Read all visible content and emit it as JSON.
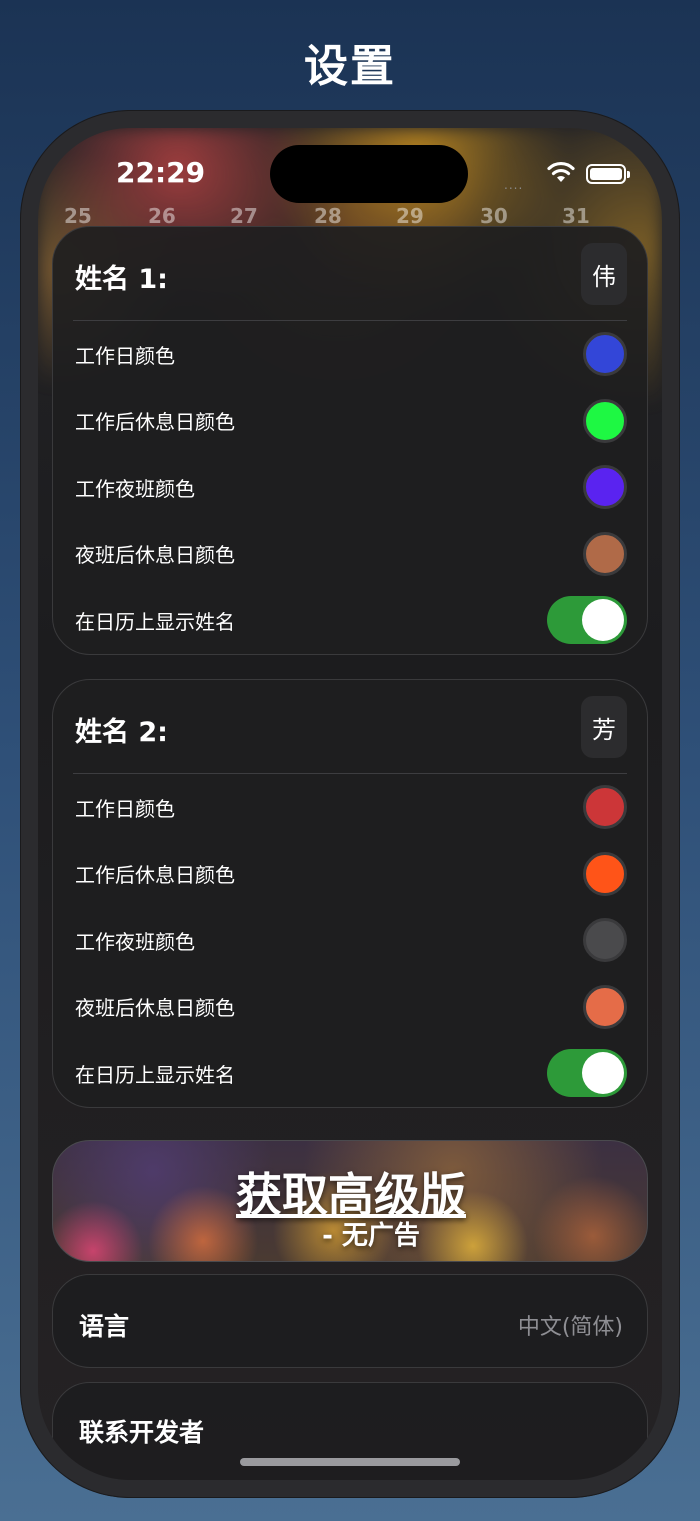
{
  "page": {
    "title": "设置"
  },
  "status_bar": {
    "time": "22:29",
    "signal": "....",
    "wifi_icon": "wifi-icon",
    "battery_icon": "battery-full-icon"
  },
  "calendar_strip": [
    "25",
    "26",
    "27",
    "28",
    "29",
    "30",
    "31"
  ],
  "person1": {
    "title": "姓名 1:",
    "badge": "伟",
    "rows": [
      {
        "label": "工作日颜色",
        "color": "#3346d8"
      },
      {
        "label": "工作后休息日颜色",
        "color": "#1ef843"
      },
      {
        "label": "工作夜班颜色",
        "color": "#5a23f0"
      },
      {
        "label": "夜班后休息日颜色",
        "color": "#b06a48"
      }
    ],
    "toggle": {
      "label": "在日历上显示姓名",
      "on": true
    }
  },
  "person2": {
    "title": "姓名 2:",
    "badge": "芳",
    "rows": [
      {
        "label": "工作日颜色",
        "color": "#cc3638"
      },
      {
        "label": "工作后休息日颜色",
        "color": "#ff5418"
      },
      {
        "label": "工作夜班颜色",
        "color": "#4a4a4c"
      },
      {
        "label": "夜班后休息日颜色",
        "color": "#e56c48"
      }
    ],
    "toggle": {
      "label": "在日历上显示姓名",
      "on": true
    }
  },
  "premium": {
    "title": "获取高级版",
    "subtitle": "- 无广告"
  },
  "language": {
    "label": "语言",
    "value": "中文(简体)"
  },
  "contact": {
    "label": "联系开发者"
  }
}
